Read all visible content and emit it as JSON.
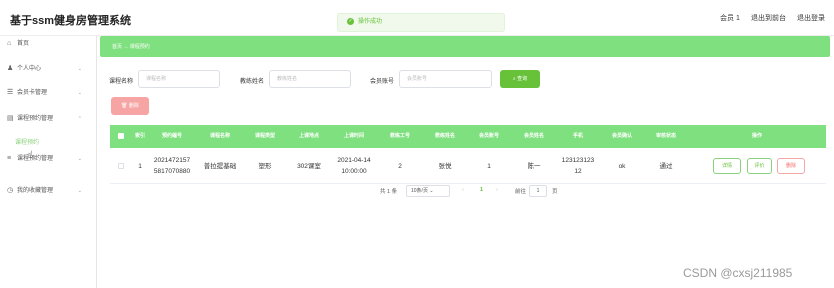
{
  "app": {
    "title": "基于ssm健身房管理系统"
  },
  "toast": {
    "message": "操作成功"
  },
  "header": {
    "user_label": "会员 1",
    "front_link": "退出到前台",
    "logout_link": "退出登录"
  },
  "sidebar": {
    "items": [
      {
        "label": "首页",
        "icon": "home-icon"
      },
      {
        "label": "个人中心",
        "icon": "user-icon"
      },
      {
        "label": "会员卡管理",
        "icon": "card-icon"
      },
      {
        "label": "课程预约管理",
        "icon": "calendar-icon"
      },
      {
        "label": "课程预约管理",
        "icon": "list-icon"
      },
      {
        "label": "我的收藏管理",
        "icon": "clock-icon"
      }
    ],
    "sub_item": "课程预约"
  },
  "breadcrumb": {
    "home": "首页",
    "current": "课程预约"
  },
  "search": {
    "course_name_label": "课程名称",
    "course_name_placeholder": "课程名称",
    "teacher_label": "教练姓名",
    "teacher_placeholder": "教练姓名",
    "member_label": "会员账号",
    "member_placeholder": "会员账号",
    "query_button": "查询"
  },
  "actions": {
    "delete_button": "删除"
  },
  "table": {
    "headers": [
      "索引",
      "预约编号",
      "课程名称",
      "课程类型",
      "上课地点",
      "上课时间",
      "教练工号",
      "教练姓名",
      "会员账号",
      "会员姓名",
      "手机",
      "会员确认",
      "审核状态",
      "操作"
    ],
    "rows": [
      {
        "index": "1",
        "booking_no": "2021472157\n5817070880",
        "course_name": "普拉提基础",
        "course_type": "塑形",
        "location": "302课室",
        "time": "2021-04-14\n10:00:00",
        "coach_no": "2",
        "coach_name": "张悦",
        "member_no": "1",
        "member_name": "陈一",
        "phone": "123123123\n12",
        "confirm": "ok",
        "status": "通过",
        "btn_detail": "详情",
        "btn_eval": "评价",
        "btn_delete": "删除"
      }
    ]
  },
  "pagination": {
    "total": "共 1 条",
    "page_size": "10条/页",
    "prev": "‹",
    "page": "1",
    "next": "›",
    "goto_label": "前往",
    "goto_value": "1",
    "page_suffix": "页"
  },
  "watermark": "CSDN @cxsj211985"
}
